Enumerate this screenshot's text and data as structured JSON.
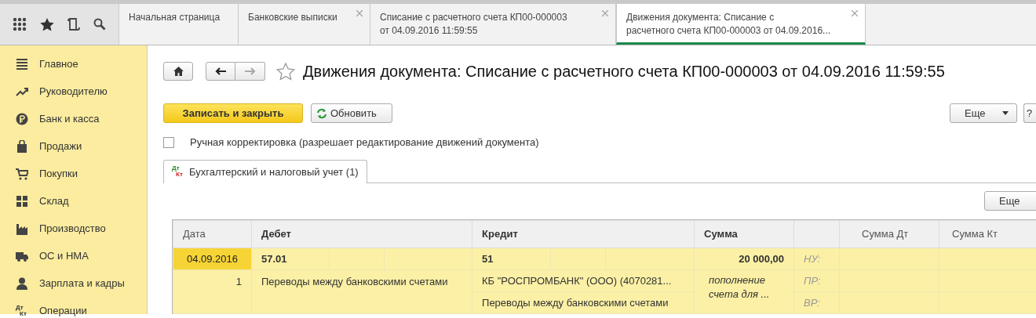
{
  "tabs": [
    {
      "label": "Начальная страница",
      "closable": false,
      "selected": false
    },
    {
      "label": "Банковские выписки",
      "closable": true,
      "selected": false
    },
    {
      "lines": [
        "Списание с расчетного счета КП00-000003",
        "от 04.09.2016 11:59:55"
      ],
      "closable": true,
      "selected": false
    },
    {
      "lines": [
        "Движения документа: Списание с",
        "расчетного счета КП00-000003 от 04.09.2016..."
      ],
      "closable": true,
      "selected": true
    }
  ],
  "sidebar": {
    "items": [
      {
        "label": "Главное"
      },
      {
        "label": "Руководителю"
      },
      {
        "label": "Банк и касса"
      },
      {
        "label": "Продажи"
      },
      {
        "label": "Покупки"
      },
      {
        "label": "Склад"
      },
      {
        "label": "Производство"
      },
      {
        "label": "ОС и НМА"
      },
      {
        "label": "Зарплата и кадры"
      },
      {
        "label": "Операции",
        "icon_text": [
          "Дт",
          "Кт"
        ]
      }
    ]
  },
  "form": {
    "title": "Движения документа: Списание с расчетного счета КП00-000003 от 04.09.2016 11:59:55",
    "favorite": false,
    "buttons": [
      {
        "label": "Записать и закрыть",
        "kind": "primary"
      },
      {
        "label": "Обновить",
        "kind": "refresh"
      }
    ],
    "more_button": "Еще",
    "help_button": "?",
    "manual_edit": {
      "label": "Ручная корректировка (разрешает редактирование движений документа)",
      "checked": false
    },
    "subtabs": [
      {
        "label": "Бухгалтерский и налоговый учет (1)",
        "icon_text": [
          "Дт",
          "Кт"
        ],
        "selected": true
      }
    ],
    "table": {
      "more_button": "Еще",
      "columns": [
        "Дата",
        "Дебет",
        "Кредит",
        "Сумма",
        "Сумма Дт",
        "Сумма Кт"
      ],
      "rows": [
        {
          "date": "04.09.2016",
          "number": "1",
          "selected": true,
          "debit": {
            "account": "57.01",
            "subconto": "Переводы между банковскими счетами"
          },
          "credit": {
            "account": "51",
            "subconto_1": "КБ \"РОСПРОМБАНК\" (ООО) (4070281...",
            "subconto_2": "Переводы между банковскими счетами"
          },
          "amount": "20 000,00",
          "content": "пополнение счета для ...",
          "tax_labels": [
            "НУ:",
            "ПР:",
            "ВР:"
          ]
        }
      ]
    }
  }
}
